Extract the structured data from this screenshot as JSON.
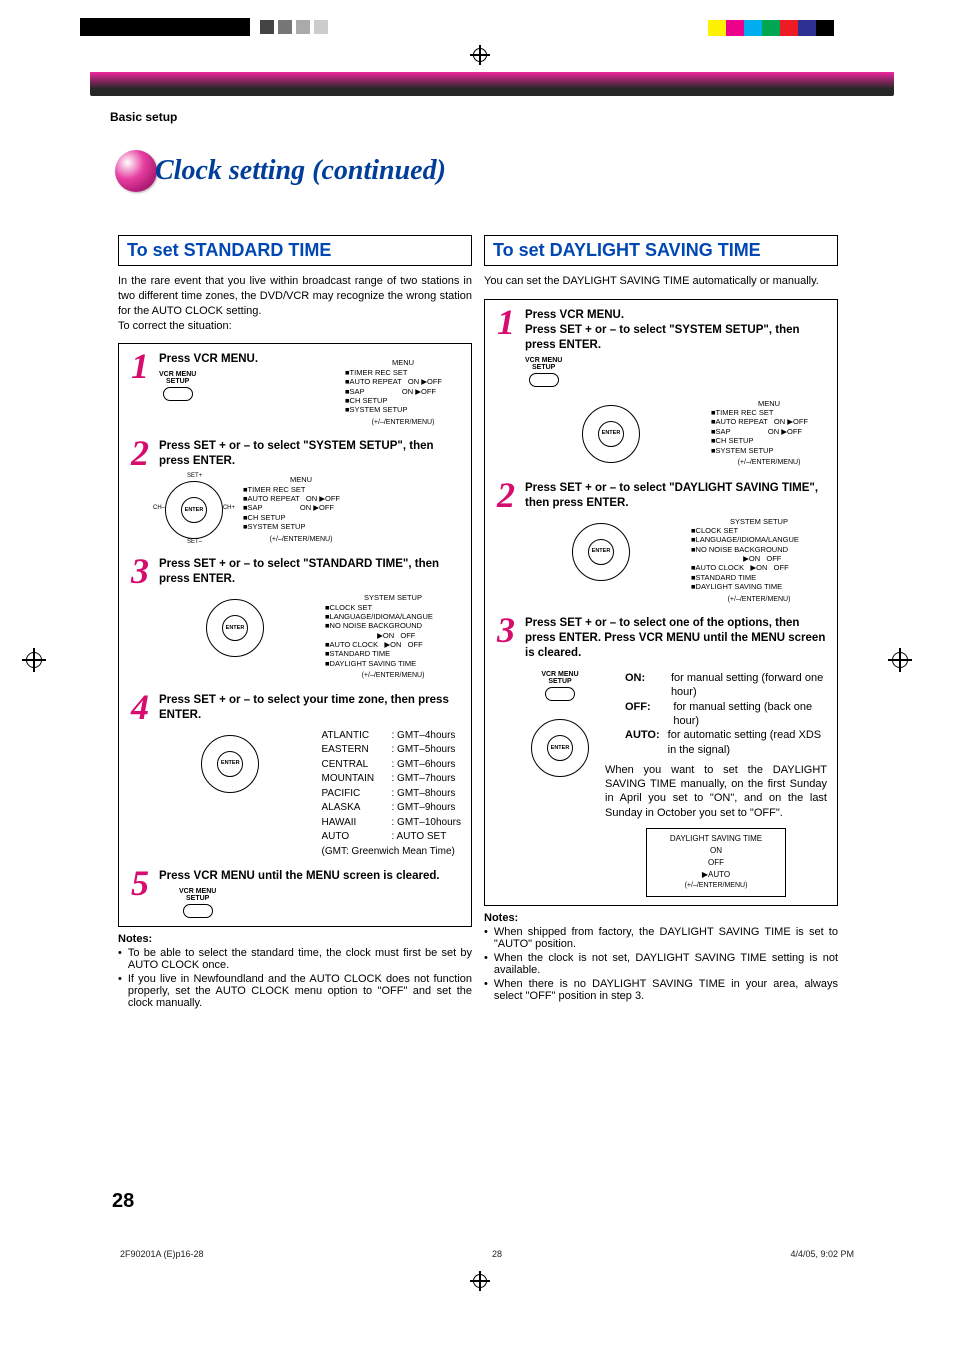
{
  "breadcrumb": "Basic setup",
  "title": "Clock setting (continued)",
  "left": {
    "heading": "To set STANDARD TIME",
    "intro": "In the rare event that you live within broadcast range of two stations in two different time zones, the DVD/VCR may recognize the wrong station for the AUTO CLOCK setting.\nTo correct the situation:",
    "steps": {
      "s1": {
        "lead": "Press VCR MENU."
      },
      "s2": {
        "lead": "Press SET + or – to select \"SYSTEM SETUP\", then press ENTER."
      },
      "s3": {
        "lead": "Press SET + or – to select \"STANDARD TIME\", then press ENTER."
      },
      "s4": {
        "lead": "Press SET + or – to select your time zone, then press ENTER."
      },
      "s5": {
        "lead": "Press VCR MENU until the MENU screen is cleared."
      }
    },
    "timezones": [
      {
        "zone": "ATLANTIC",
        "off": ": GMT–4hours"
      },
      {
        "zone": "EASTERN",
        "off": ": GMT–5hours"
      },
      {
        "zone": "CENTRAL",
        "off": ": GMT–6hours"
      },
      {
        "zone": "MOUNTAIN",
        "off": ": GMT–7hours"
      },
      {
        "zone": "PACIFIC",
        "off": ": GMT–8hours"
      },
      {
        "zone": "ALASKA",
        "off": ": GMT–9hours"
      },
      {
        "zone": "HAWAII",
        "off": ": GMT–10hours"
      },
      {
        "zone": "AUTO",
        "off": ": AUTO SET"
      }
    ],
    "tz_note": "(GMT: Greenwich Mean Time)",
    "notes_hd": "Notes:",
    "notes": [
      "To be able to select the standard time, the clock must first be set by AUTO CLOCK once.",
      "If you live in Newfoundland and the AUTO CLOCK does not function properly, set the AUTO CLOCK menu option to \"OFF\" and set the clock manually."
    ]
  },
  "right": {
    "heading": "To set DAYLIGHT SAVING TIME",
    "intro": "You can set the DAYLIGHT SAVING TIME automatically or manually.",
    "steps": {
      "s1": {
        "lead1": "Press VCR MENU.",
        "lead2": "Press SET + or – to select \"SYSTEM SETUP\", then press ENTER."
      },
      "s2": {
        "lead": "Press SET + or – to select \"DAYLIGHT SAVING TIME\", then press ENTER."
      },
      "s3": {
        "lead": "Press SET + or – to select one of the options, then press ENTER. Press VCR MENU until the MENU screen is cleared."
      }
    },
    "options": {
      "on_k": "ON:",
      "on_v": "for manual setting (forward one hour)",
      "off_k": "OFF:",
      "off_v": "for manual setting (back one hour)",
      "auto_k": "AUTO:",
      "auto_v": "for automatic setting (read XDS in the signal)"
    },
    "dst_para": "When you want to set the DAYLIGHT SAVING TIME manually, on the first Sunday in April you set to \"ON\", and on the last Sunday in October you set to \"OFF\".",
    "dst_osd": {
      "title": "DAYLIGHT SAVING TIME",
      "l1": "ON",
      "l2": "OFF",
      "l3": "▶AUTO",
      "hint": "(+/–/ENTER/MENU)"
    },
    "notes_hd": "Notes:",
    "notes": [
      "When shipped from factory, the DAYLIGHT SAVING TIME is set to \"AUTO\" position.",
      "When the clock is not set, DAYLIGHT SAVING TIME setting is not available.",
      "When there is no DAYLIGHT SAVING TIME in your area, always select \"OFF\" position in step 3."
    ]
  },
  "osd": {
    "menu_title": "MENU",
    "menu_lines": [
      "■TIMER REC SET",
      "■AUTO REPEAT   ON ▶OFF",
      "■SAP                  ON ▶OFF",
      "■CH SETUP",
      "■SYSTEM SETUP"
    ],
    "hint": "(+/–/ENTER/MENU)",
    "sys_title": "SYSTEM SETUP",
    "sys_lines": [
      "■CLOCK SET",
      "■LANGUAGE/IDIOMA/LANGUE",
      "■NO NOISE BACKGROUND",
      "                         ▶ON   OFF",
      "■AUTO CLOCK   ▶ON   OFF",
      "■STANDARD TIME",
      "■DAYLIGHT SAVING TIME"
    ]
  },
  "vcr_btn": {
    "l1": "VCR MENU",
    "l2": "SETUP"
  },
  "dpad": {
    "center": "ENTER",
    "top": "SET+",
    "bottom": "SET–",
    "left": "CH–",
    "right": "CH+"
  },
  "page_number": "28",
  "footer": {
    "file": "2F90201A (E)p16-28",
    "page": "28",
    "ts": "4/4/05, 9:02 PM"
  }
}
